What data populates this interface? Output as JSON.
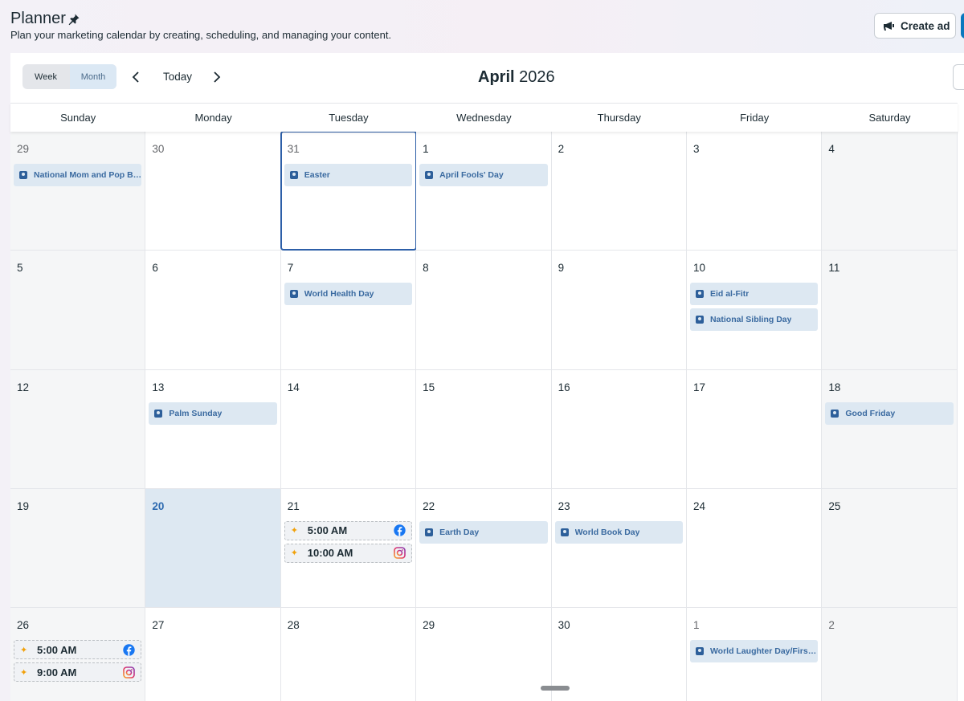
{
  "header": {
    "title": "Planner",
    "subtitle": "Plan your marketing calendar by creating, scheduling, and managing your content.",
    "create_ad_label": "Create ad"
  },
  "toolbar": {
    "view_week": "Week",
    "view_month": "Month",
    "selected_view": "Month",
    "today_label": "Today",
    "month": "April",
    "year": "2026"
  },
  "colors": {
    "accent": "#2d6ab0",
    "event_bg": "#dde8f2",
    "today_bg": "#dde8f2",
    "selected_outline": "#2d5fa8"
  },
  "day_names": [
    "Sunday",
    "Monday",
    "Tuesday",
    "Wednesday",
    "Thursday",
    "Friday",
    "Saturday"
  ],
  "weeks": [
    {
      "days": [
        {
          "num": "29",
          "muted": true,
          "weekend": true,
          "events": [
            {
              "label": "National Mom and Pop Business Owners Day"
            }
          ]
        },
        {
          "num": "30",
          "muted": true,
          "events": []
        },
        {
          "num": "31",
          "muted": true,
          "selected": true,
          "events": [
            {
              "label": "Easter"
            }
          ]
        },
        {
          "num": "1",
          "events": [
            {
              "label": "April Fools' Day"
            }
          ]
        },
        {
          "num": "2",
          "events": []
        },
        {
          "num": "3",
          "events": []
        },
        {
          "num": "4",
          "weekend": true,
          "events": []
        }
      ]
    },
    {
      "days": [
        {
          "num": "5",
          "weekend": true,
          "events": []
        },
        {
          "num": "6",
          "events": []
        },
        {
          "num": "7",
          "events": [
            {
              "label": "World Health Day"
            }
          ]
        },
        {
          "num": "8",
          "events": []
        },
        {
          "num": "9",
          "events": []
        },
        {
          "num": "10",
          "events": [
            {
              "label": "Eid al-Fitr"
            },
            {
              "label": "National Sibling Day"
            }
          ]
        },
        {
          "num": "11",
          "weekend": true,
          "events": []
        }
      ]
    },
    {
      "days": [
        {
          "num": "12",
          "weekend": true,
          "events": []
        },
        {
          "num": "13",
          "events": [
            {
              "label": "Palm Sunday"
            }
          ]
        },
        {
          "num": "14",
          "events": []
        },
        {
          "num": "15",
          "events": []
        },
        {
          "num": "16",
          "events": []
        },
        {
          "num": "17",
          "events": []
        },
        {
          "num": "18",
          "weekend": true,
          "events": [
            {
              "label": "Good Friday"
            }
          ]
        }
      ]
    },
    {
      "days": [
        {
          "num": "19",
          "weekend": true,
          "events": []
        },
        {
          "num": "20",
          "today": true,
          "events": []
        },
        {
          "num": "21",
          "events": [],
          "posts": [
            {
              "time": "5:00 AM",
              "platform": "facebook-icon"
            },
            {
              "time": "10:00 AM",
              "platform": "instagram-icon"
            }
          ]
        },
        {
          "num": "22",
          "events": [
            {
              "label": "Earth Day"
            }
          ]
        },
        {
          "num": "23",
          "events": [
            {
              "label": "World Book Day"
            }
          ]
        },
        {
          "num": "24",
          "events": []
        },
        {
          "num": "25",
          "weekend": true,
          "events": []
        }
      ]
    },
    {
      "days": [
        {
          "num": "26",
          "weekend": true,
          "events": [],
          "posts": [
            {
              "time": "5:00 AM",
              "platform": "facebook-icon"
            },
            {
              "time": "9:00 AM",
              "platform": "instagram-icon"
            }
          ]
        },
        {
          "num": "27",
          "events": []
        },
        {
          "num": "28",
          "events": []
        },
        {
          "num": "29",
          "events": []
        },
        {
          "num": "30",
          "events": []
        },
        {
          "num": "1",
          "muted": true,
          "events": [
            {
              "label": "World Laughter Day/First Day of Ramadan"
            }
          ]
        },
        {
          "num": "2",
          "muted": true,
          "weekend": true,
          "events": []
        }
      ]
    }
  ]
}
